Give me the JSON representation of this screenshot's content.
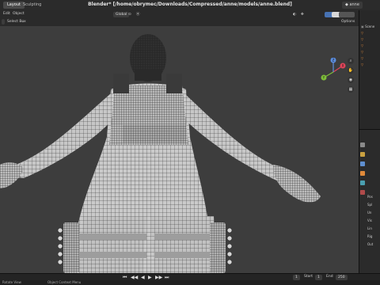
{
  "window": {
    "title": "Blender* [/home/obrymec/Downloads/Compressed/anne/models/anne.blend]"
  },
  "workspace_tabs": [
    {
      "label": "Layout",
      "active": true
    },
    {
      "label": "Sculpting",
      "active": false
    }
  ],
  "scene": {
    "name": "anne"
  },
  "header": {
    "edit": "Edit",
    "object": "Object",
    "select_box": "Select Box",
    "transform_orientation": "Global",
    "options": "Options"
  },
  "gizmo": {
    "x": "X",
    "y": "Y",
    "z": "Z"
  },
  "outliner": {
    "items": [
      "Scene",
      "",
      "",
      "",
      "",
      "",
      ""
    ],
    "colors": [
      "#8a8a8a",
      "#e08a3a",
      "#e08a3a",
      "#e08a3a",
      "#e08a3a",
      "#e08a3a",
      "#e08a3a"
    ]
  },
  "properties": {
    "rows": [
      "Pos",
      "Spl",
      "Un",
      "Vis",
      "Lin",
      "Rig",
      "Out"
    ]
  },
  "timeline": {
    "current_frame": "1",
    "start_label": "Start",
    "start": "1",
    "end_label": "End",
    "end": "250"
  },
  "statusbar": {
    "left": "Rotate View",
    "middle": "Object Context Menu"
  },
  "colors": {
    "viewport_bg": "#3d3d3d",
    "mesh": "#c9c9c9",
    "wire": "#2a2a2a",
    "accent": "#4772b3"
  }
}
